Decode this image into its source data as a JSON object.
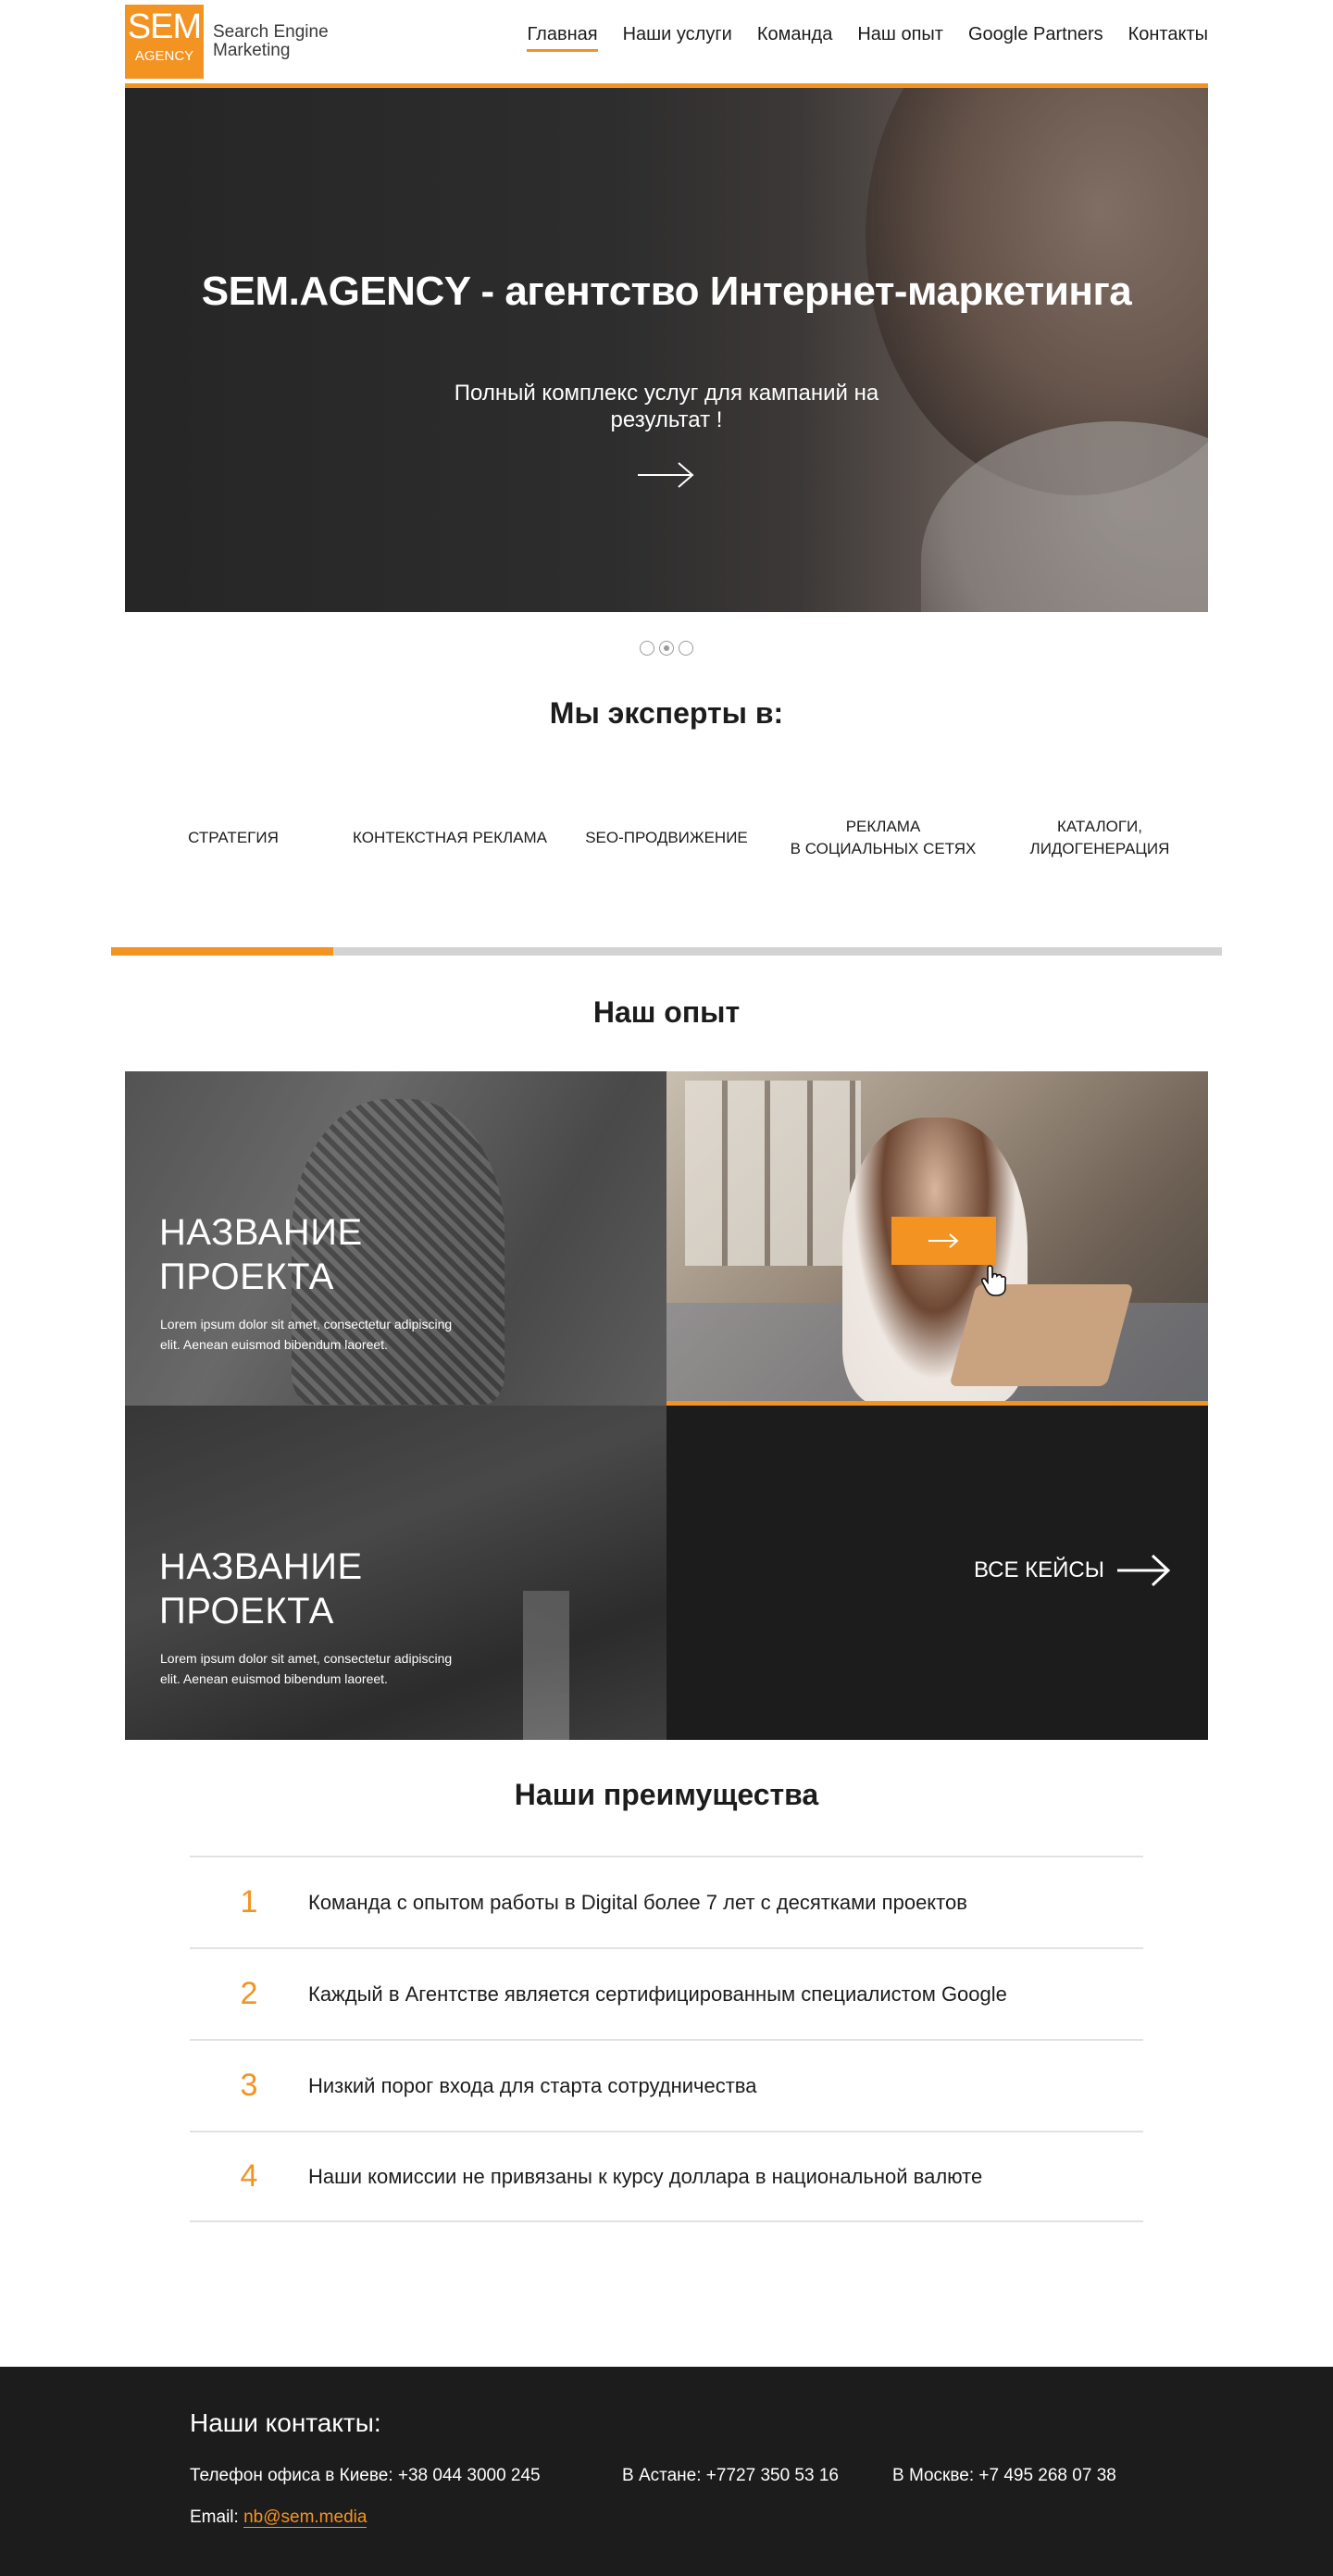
{
  "header": {
    "logo_sem": "SEM",
    "logo_agency": "AGENCY",
    "logo_line1": "Search Engine",
    "logo_line2": "Marketing",
    "nav": [
      "Главная",
      "Наши услуги",
      "Команда",
      "Наш опыт",
      "Google Partners",
      "Контакты"
    ],
    "active_nav": "Главная"
  },
  "hero": {
    "title": "SEM.AGENCY - агентство Интернет-маркетинга",
    "subtitle_line1": "Полный комплекс услуг для кампаний на",
    "subtitle_line2": "результат !",
    "arrow_icon": "arrow-right-icon",
    "slides_count": 3,
    "active_slide": 2
  },
  "experts": {
    "title": "Мы эксперты в:",
    "items": [
      {
        "line1": "Стратегия",
        "line2": ""
      },
      {
        "line1": "Контекстная реклама",
        "line2": ""
      },
      {
        "line1": "SEO-продвижение",
        "line2": ""
      },
      {
        "line1": "Реклама",
        "line2": "в социальных сетях"
      },
      {
        "line1": "Каталоги,",
        "line2": "лидогенерация"
      }
    ],
    "progress": 0.2
  },
  "cases": {
    "title": "Наш опыт",
    "projects": [
      {
        "title_line1": "Название",
        "title_line2": "проекта",
        "text_line1": "Lorem ipsum dolor sit amet, consectetur adipiscing",
        "text_line2": "elit. Aenean euismod bibendum laoreet."
      },
      {
        "title_line1": "Название",
        "title_line2": "проекта",
        "text_line1": "Lorem ipsum dolor sit amet, consectetur adipiscing",
        "text_line2": "elit. Aenean euismod bibendum laoreet."
      }
    ],
    "all_cases_label": "ВСЕ КЕЙСЫ"
  },
  "advantages": {
    "title": "Наши преимущества",
    "items": [
      {
        "num": "1",
        "text": "Команда с опытом работы в Digital более 7 лет с десятками проектов"
      },
      {
        "num": "2",
        "text": "Каждый в Агентстве является сертифицированным специалистом Google"
      },
      {
        "num": "3",
        "text": "Низкий порог входа для старта сотрудничества"
      },
      {
        "num": "4",
        "text": "Наши комиссии не привязаны к курсу доллара в национальной валюте"
      }
    ]
  },
  "footer": {
    "title": "Наши контакты:",
    "phone_kiev": "Телефон офиса в Киеве: +38 044 3000 245",
    "phone_astana": "В Астане: +7727 350 53 16",
    "phone_moscow": "В Москве: +7 495 268 07 38",
    "email_label": "Email:",
    "email": "nb@sem.media"
  },
  "colors": {
    "accent": "#f39322",
    "dark": "#1c1c1c",
    "divider": "#e2e2e2"
  }
}
